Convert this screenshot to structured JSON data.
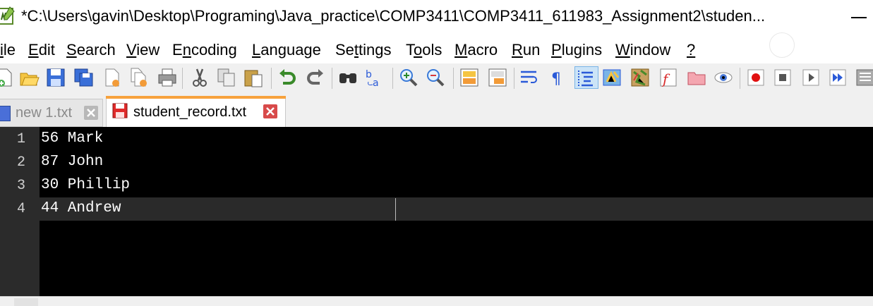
{
  "window": {
    "title": "*C:\\Users\\gavin\\Desktop\\Programing\\Java_practice\\COMP3411\\COMP3411_611983_Assignment2\\studen..."
  },
  "menu": {
    "items": [
      "ile",
      "Edit",
      "Search",
      "View",
      "Encoding",
      "Language",
      "Settings",
      "Tools",
      "Macro",
      "Run",
      "Plugins",
      "Window",
      "?"
    ]
  },
  "toolbar": {
    "icons": [
      "new-file",
      "open-file",
      "save",
      "save-all",
      "close",
      "close-all",
      "print",
      "cut",
      "copy",
      "paste",
      "undo",
      "redo",
      "find",
      "replace",
      "zoom-in",
      "zoom-out",
      "sync-vertical",
      "sync-horizontal",
      "word-wrap",
      "show-all-chars",
      "indent-guide",
      "language-udl",
      "document-map",
      "function-list",
      "folder-as-workspace",
      "monitoring",
      "record-macro",
      "stop-recording",
      "playback-macro",
      "run-macro-multiple",
      "save-macro"
    ]
  },
  "tabs": [
    {
      "label": "new 1.txt",
      "active": false
    },
    {
      "label": "student_record.txt",
      "active": true
    }
  ],
  "editor": {
    "lines": [
      {
        "number": "1",
        "text": "56 Mark"
      },
      {
        "number": "2",
        "text": "87 John"
      },
      {
        "number": "3",
        "text": "30 Phillip"
      },
      {
        "number": "4",
        "text": "44 Andrew"
      }
    ],
    "current_line": 4
  },
  "colors": {
    "accent_tab": "#f7a23c",
    "editor_bg": "#000000",
    "text": "#ffffff",
    "gutter_bg": "#2b2b2b",
    "record_red": "#e01010"
  }
}
